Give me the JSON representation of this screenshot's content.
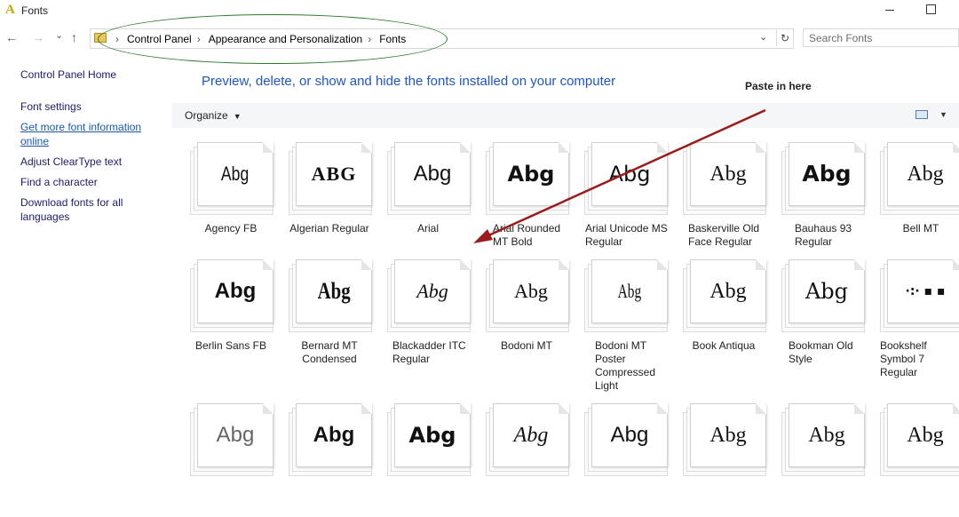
{
  "window": {
    "title": "Fonts",
    "app_icon_glyph": "A"
  },
  "nav": {
    "back": "←",
    "forward": "→",
    "recent": "⌄",
    "up": "↑"
  },
  "address": {
    "crumbs": [
      "Control Panel",
      "Appearance and Personalization",
      "Fonts"
    ],
    "separator": "›"
  },
  "search": {
    "placeholder": "Search Fonts"
  },
  "sidebar": {
    "links": [
      {
        "label": "Control Panel Home"
      },
      {
        "label": "Font settings"
      },
      {
        "label": "Get more font information online"
      },
      {
        "label": "Adjust ClearType text"
      },
      {
        "label": "Find a character"
      },
      {
        "label": "Download fonts for all languages"
      }
    ]
  },
  "main": {
    "heading": "Preview, delete, or show and hide the fonts installed on your computer",
    "paste_note": "Paste in here",
    "organize_label": "Organize",
    "annotation_colors": {
      "ellipse": "#2a7a2a",
      "arrow": "#9b1c1c"
    }
  },
  "fonts": [
    {
      "name": "Agency FB",
      "preview": "Abg"
    },
    {
      "name": "Algerian Regular",
      "preview": "ABG"
    },
    {
      "name": "Arial",
      "preview": "Abg"
    },
    {
      "name": "Arial Rounded MT Bold",
      "preview": "Abg"
    },
    {
      "name": "Arial Unicode MS Regular",
      "preview": "Abg"
    },
    {
      "name": "Baskerville Old Face Regular",
      "preview": "Abg"
    },
    {
      "name": "Bauhaus 93 Regular",
      "preview": "Abg"
    },
    {
      "name": "Bell MT",
      "preview": "Abg"
    },
    {
      "name": "Berlin Sans FB",
      "preview": "Abg"
    },
    {
      "name": "Bernard MT Condensed",
      "preview": "Abg"
    },
    {
      "name": "Blackadder ITC Regular",
      "preview": "Abg"
    },
    {
      "name": "Bodoni MT",
      "preview": "Abg"
    },
    {
      "name": "Bodoni MT Poster Compressed Light",
      "preview": "Abg"
    },
    {
      "name": "Book Antiqua",
      "preview": "Abg"
    },
    {
      "name": "Bookman Old Style",
      "preview": "Abg"
    },
    {
      "name": "Bookshelf Symbol 7 Regular",
      "preview": "·:· ▪ ▪"
    },
    {
      "name": "",
      "preview": "Abg"
    },
    {
      "name": "",
      "preview": "Abg"
    },
    {
      "name": "",
      "preview": "Abg"
    },
    {
      "name": "",
      "preview": "Abg"
    },
    {
      "name": "",
      "preview": "Abg"
    },
    {
      "name": "",
      "preview": "Abg"
    },
    {
      "name": "",
      "preview": "Abg"
    },
    {
      "name": "",
      "preview": "Abg"
    }
  ]
}
